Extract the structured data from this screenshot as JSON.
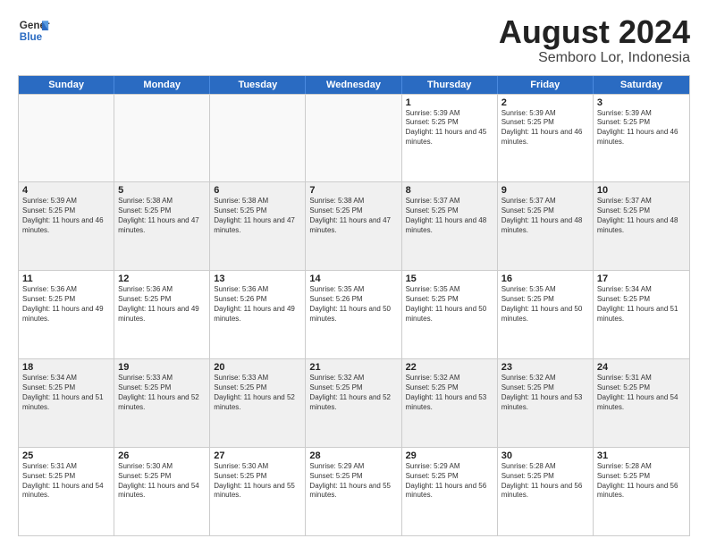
{
  "header": {
    "logo_line1": "General",
    "logo_line2": "Blue",
    "title": "August 2024",
    "subtitle": "Semboro Lor, Indonesia"
  },
  "days_of_week": [
    "Sunday",
    "Monday",
    "Tuesday",
    "Wednesday",
    "Thursday",
    "Friday",
    "Saturday"
  ],
  "weeks": [
    [
      {
        "day": "",
        "empty": true
      },
      {
        "day": "",
        "empty": true
      },
      {
        "day": "",
        "empty": true
      },
      {
        "day": "",
        "empty": true
      },
      {
        "day": "1",
        "sunrise": "5:39 AM",
        "sunset": "5:25 PM",
        "daylight": "11 hours and 45 minutes."
      },
      {
        "day": "2",
        "sunrise": "5:39 AM",
        "sunset": "5:25 PM",
        "daylight": "11 hours and 46 minutes."
      },
      {
        "day": "3",
        "sunrise": "5:39 AM",
        "sunset": "5:25 PM",
        "daylight": "11 hours and 46 minutes."
      }
    ],
    [
      {
        "day": "4",
        "sunrise": "5:39 AM",
        "sunset": "5:25 PM",
        "daylight": "11 hours and 46 minutes."
      },
      {
        "day": "5",
        "sunrise": "5:38 AM",
        "sunset": "5:25 PM",
        "daylight": "11 hours and 47 minutes."
      },
      {
        "day": "6",
        "sunrise": "5:38 AM",
        "sunset": "5:25 PM",
        "daylight": "11 hours and 47 minutes."
      },
      {
        "day": "7",
        "sunrise": "5:38 AM",
        "sunset": "5:25 PM",
        "daylight": "11 hours and 47 minutes."
      },
      {
        "day": "8",
        "sunrise": "5:37 AM",
        "sunset": "5:25 PM",
        "daylight": "11 hours and 48 minutes."
      },
      {
        "day": "9",
        "sunrise": "5:37 AM",
        "sunset": "5:25 PM",
        "daylight": "11 hours and 48 minutes."
      },
      {
        "day": "10",
        "sunrise": "5:37 AM",
        "sunset": "5:25 PM",
        "daylight": "11 hours and 48 minutes."
      }
    ],
    [
      {
        "day": "11",
        "sunrise": "5:36 AM",
        "sunset": "5:25 PM",
        "daylight": "11 hours and 49 minutes."
      },
      {
        "day": "12",
        "sunrise": "5:36 AM",
        "sunset": "5:25 PM",
        "daylight": "11 hours and 49 minutes."
      },
      {
        "day": "13",
        "sunrise": "5:36 AM",
        "sunset": "5:26 PM",
        "daylight": "11 hours and 49 minutes."
      },
      {
        "day": "14",
        "sunrise": "5:35 AM",
        "sunset": "5:26 PM",
        "daylight": "11 hours and 50 minutes."
      },
      {
        "day": "15",
        "sunrise": "5:35 AM",
        "sunset": "5:25 PM",
        "daylight": "11 hours and 50 minutes."
      },
      {
        "day": "16",
        "sunrise": "5:35 AM",
        "sunset": "5:25 PM",
        "daylight": "11 hours and 50 minutes."
      },
      {
        "day": "17",
        "sunrise": "5:34 AM",
        "sunset": "5:25 PM",
        "daylight": "11 hours and 51 minutes."
      }
    ],
    [
      {
        "day": "18",
        "sunrise": "5:34 AM",
        "sunset": "5:25 PM",
        "daylight": "11 hours and 51 minutes."
      },
      {
        "day": "19",
        "sunrise": "5:33 AM",
        "sunset": "5:25 PM",
        "daylight": "11 hours and 52 minutes."
      },
      {
        "day": "20",
        "sunrise": "5:33 AM",
        "sunset": "5:25 PM",
        "daylight": "11 hours and 52 minutes."
      },
      {
        "day": "21",
        "sunrise": "5:32 AM",
        "sunset": "5:25 PM",
        "daylight": "11 hours and 52 minutes."
      },
      {
        "day": "22",
        "sunrise": "5:32 AM",
        "sunset": "5:25 PM",
        "daylight": "11 hours and 53 minutes."
      },
      {
        "day": "23",
        "sunrise": "5:32 AM",
        "sunset": "5:25 PM",
        "daylight": "11 hours and 53 minutes."
      },
      {
        "day": "24",
        "sunrise": "5:31 AM",
        "sunset": "5:25 PM",
        "daylight": "11 hours and 54 minutes."
      }
    ],
    [
      {
        "day": "25",
        "sunrise": "5:31 AM",
        "sunset": "5:25 PM",
        "daylight": "11 hours and 54 minutes."
      },
      {
        "day": "26",
        "sunrise": "5:30 AM",
        "sunset": "5:25 PM",
        "daylight": "11 hours and 54 minutes."
      },
      {
        "day": "27",
        "sunrise": "5:30 AM",
        "sunset": "5:25 PM",
        "daylight": "11 hours and 55 minutes."
      },
      {
        "day": "28",
        "sunrise": "5:29 AM",
        "sunset": "5:25 PM",
        "daylight": "11 hours and 55 minutes."
      },
      {
        "day": "29",
        "sunrise": "5:29 AM",
        "sunset": "5:25 PM",
        "daylight": "11 hours and 56 minutes."
      },
      {
        "day": "30",
        "sunrise": "5:28 AM",
        "sunset": "5:25 PM",
        "daylight": "11 hours and 56 minutes."
      },
      {
        "day": "31",
        "sunrise": "5:28 AM",
        "sunset": "5:25 PM",
        "daylight": "11 hours and 56 minutes."
      }
    ]
  ],
  "labels": {
    "sunrise": "Sunrise:",
    "sunset": "Sunset:",
    "daylight": "Daylight:"
  }
}
